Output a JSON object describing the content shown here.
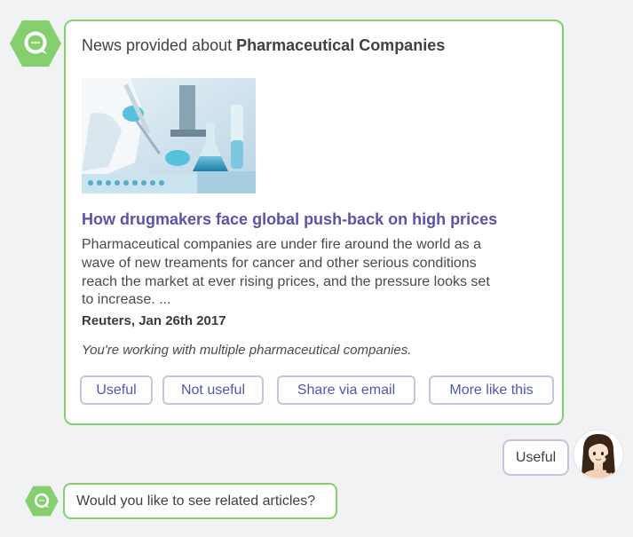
{
  "colors": {
    "bot_green": "#86cf6f",
    "link_purple": "#5b53aa",
    "button_border": "#c5c4de",
    "button_text": "#4f58b0",
    "background": "#f1f2f4"
  },
  "bot": {
    "avatar_icon": "chat-bubble-icon"
  },
  "news_card": {
    "header_prefix": "News provided about",
    "topic": "Pharmaceutical Companies",
    "image_icon": "laboratory-photo",
    "title": "How drugmakers face global push-back on high prices",
    "summary": "Pharmaceutical companies are under fire around the world as a wave of new treaments for cancer and other serious conditions reach the market at ever rising prices, and the pressure looks set to increase. ...",
    "source": "Reuters, Jan 26th 2017",
    "context": "You're working with multiple pharmaceutical companies.",
    "actions": [
      "Useful",
      "Not useful",
      "Share via email",
      "More like this"
    ]
  },
  "user_reply": {
    "text": "Useful",
    "avatar_icon": "user-avatar-icon"
  },
  "bot_followup": {
    "text": "Would you like to see related articles?"
  }
}
